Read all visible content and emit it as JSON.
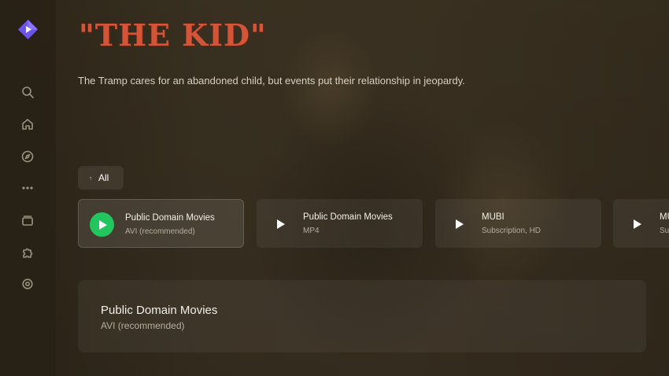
{
  "movie": {
    "title": "\"THE KID\"",
    "description": "The Tramp cares for an abandoned child, but events put their relationship in jeopardy."
  },
  "filter": {
    "label": "All",
    "arrow": "↑"
  },
  "streams": [
    {
      "name": "Public Domain Movies",
      "sub": "AVI (recommended)",
      "selected": true
    },
    {
      "name": "Public Domain Movies",
      "sub": "MP4"
    },
    {
      "name": "MUBI",
      "sub": "Subscription, HD"
    },
    {
      "name": "MUBI",
      "sub": "Subscription, SD"
    }
  ],
  "detail": {
    "name": "Public Domain Movies",
    "sub": "AVI (recommended)"
  },
  "nav": [
    "search-icon",
    "home-icon",
    "compass-icon",
    "more-icon",
    "library-icon",
    "addons-icon",
    "settings-icon"
  ],
  "colors": {
    "accent": "#7b5bf5",
    "play_green": "#22c55e",
    "title_red": "#d35437"
  }
}
